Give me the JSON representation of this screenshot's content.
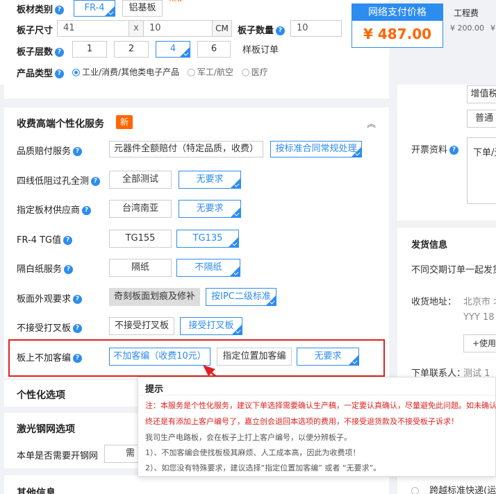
{
  "top": {
    "board_type_label": "板材类别",
    "board_type_options": [
      "FR-4",
      "铝基板"
    ],
    "board_type_badge": "new",
    "size_label": "板子尺寸",
    "size_w": "41",
    "size_x": "x",
    "size_h": "10",
    "size_unit": "CM",
    "qty_label": "板子数量",
    "qty_value": "10",
    "layers_label": "板子层数",
    "layers_options": [
      "1",
      "2",
      "4",
      "6"
    ],
    "sample_order": "样板订单",
    "product_type_label": "产品类型",
    "product_types": [
      "工业/消费/其他类电子产品",
      "军工/航空",
      "医疗"
    ]
  },
  "price": {
    "header": "网络支付价格",
    "value": "¥ 487.00",
    "fee_label": "工程费",
    "fee_value": "¥ 200.00",
    "fee_value2": "¥"
  },
  "services": {
    "title": "收费高端个性化服务",
    "badge": "新",
    "rows": [
      {
        "label": "品质赔付服务",
        "options": [
          "元器件全额赔付（特定品质，收费）",
          "按标准合同常规处理"
        ]
      },
      {
        "label": "四线低阻过孔全测",
        "options": [
          "全部测试",
          "无要求"
        ]
      },
      {
        "label": "指定板材供应商",
        "options": [
          "台湾南亚",
          "无要求"
        ]
      },
      {
        "label": "FR-4 TG值",
        "options": [
          "TG155",
          "TG135"
        ]
      },
      {
        "label": "隔白纸服务",
        "options": [
          "隔纸",
          "不隔纸"
        ]
      },
      {
        "label": "板面外观要求",
        "options": [
          "奇刻板面划痕及修补",
          "按IPC二级标准"
        ]
      },
      {
        "label": "不接受打叉板",
        "options": [
          "不接受打叉板",
          "接受打叉板"
        ]
      },
      {
        "label": "板上不加客编",
        "options": [
          "不加客编（收费10元）",
          "指定位置加客编",
          "无要求"
        ]
      }
    ]
  },
  "personal": {
    "title": "个性化选项"
  },
  "stencil": {
    "title": "激光钢网选项",
    "question": "本单是否需要开钢网",
    "value": "需"
  },
  "other": {
    "title": "其他信息"
  },
  "tooltip": {
    "title": "提示",
    "line1": "注：本服务是个性化服务，建议下单选择需要确认生产稿，一定要认真确认，尽量避免此问题。如未确认出",
    "line2": "终还是有添加上客户编号了，嘉立创会退回本选项的费用，不接受退货款及不接受板子诉求！",
    "line3": "我司生产电路板，会在板子上打上客户编号，以便分辨板子。",
    "line4": "1）、不加客编会使找板极其麻烦、人工成本高，因此为收费项！",
    "line5": "2）、如您没有特殊要求，建议选择“指定位置加客编” 或者 “无要求”。"
  },
  "right": {
    "btn1": "增值税",
    "btn2": "普通",
    "invoice_label": "开票资料",
    "invoice_text": "下单/无",
    "ship_title": "发货信息",
    "ship_note": "不同交期订单一起发货",
    "address_label": "收货地址：",
    "address_city": "北京市 北",
    "address_line2": "YYY  18",
    "use_btn": "+使用",
    "contact_label": "下单联系人：",
    "contact_value": "测试  1",
    "express": "跨越标准快递(运费"
  }
}
